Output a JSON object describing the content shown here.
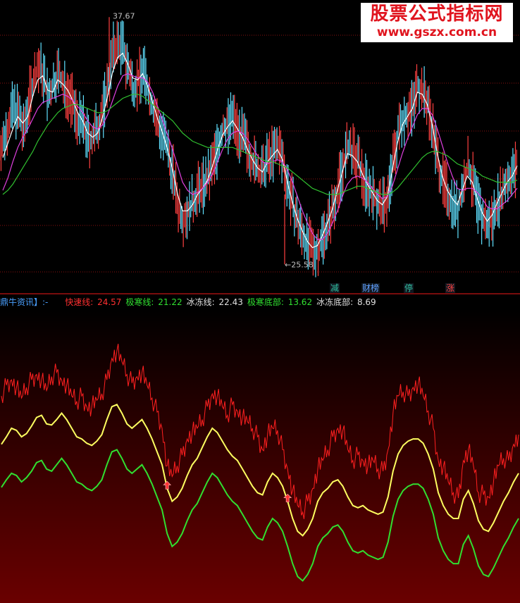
{
  "watermark": {
    "name": "股票公式指标网",
    "url": "www.gszx.com.cn"
  },
  "top_panel": {
    "high_label": "37.67",
    "low_label": "←25.58",
    "markers": [
      {
        "label": "减",
        "color": "#30c0a0"
      },
      {
        "label": "财榜",
        "color": "#60a0ff"
      },
      {
        "label": "停",
        "color": "#30c0a0"
      },
      {
        "label": "涨",
        "color": "#ff4040"
      }
    ]
  },
  "legend": {
    "title": "鼎牛资讯】:-",
    "items": [
      {
        "name": "快速线:",
        "value": "24.57",
        "color": "#ff3030"
      },
      {
        "name": "极寒线:",
        "value": "21.22",
        "color": "#30e030"
      },
      {
        "name": "冰冻线:",
        "value": "22.43",
        "color": "#e0e0e0"
      },
      {
        "name": "极寒底部:",
        "value": "13.62",
        "color": "#30e030"
      },
      {
        "name": "冰冻底部:",
        "value": "8.69",
        "color": "#e0e0e0"
      }
    ]
  },
  "chart_data": [
    {
      "type": "candlestick",
      "title": "",
      "y_range": [
        24.8,
        38.3
      ],
      "annotations": [
        {
          "text": "37.67",
          "y": 37.67
        },
        {
          "text": "←25.58",
          "y": 25.58
        }
      ],
      "close": [
        31.5,
        32.6,
        33.2,
        33.0,
        32.0,
        33.6,
        34.6,
        35.3,
        34.8,
        33.6,
        34.4,
        35.0,
        34.2,
        34.0,
        33.3,
        32.6,
        32.4,
        31.6,
        31.8,
        32.4,
        33.2,
        34.6,
        36.0,
        36.4,
        36.1,
        35.1,
        34.2,
        34.6,
        35.1,
        34.0,
        33.2,
        32.4,
        31.8,
        31.0,
        30.0,
        28.4,
        27.9,
        28.2,
        28.6,
        29.2,
        29.4,
        29.8,
        30.6,
        31.4,
        32.2,
        32.4,
        32.8,
        32.1,
        31.7,
        31.2,
        30.6,
        30.2,
        30.0,
        30.8,
        31.0,
        31.4,
        30.6,
        29.4,
        28.4,
        27.6,
        27.0,
        26.5,
        26.2,
        26.4,
        27.0,
        27.6,
        28.4,
        29.4,
        30.4,
        31.3,
        31.0,
        30.6,
        29.8,
        29.4,
        29.0,
        28.6,
        28.4,
        28.9,
        30.6,
        32.0,
        32.8,
        33.0,
        33.4,
        34.4,
        34.0,
        33.4,
        32.2,
        30.6,
        29.6,
        29.0,
        28.6,
        28.2,
        29.4,
        30.4,
        29.6,
        28.4,
        27.8,
        27.5,
        27.9,
        28.7,
        29.2,
        29.8,
        30.0,
        30.6
      ],
      "ma_lines": [
        {
          "name": "white",
          "color": "#ffffff",
          "values": [
            30.8,
            31.5,
            32.2,
            32.8,
            32.5,
            32.8,
            33.8,
            34.6,
            34.8,
            34.1,
            34.0,
            34.6,
            34.4,
            34.1,
            33.6,
            33.0,
            32.6,
            32.0,
            31.8,
            32.0,
            32.8,
            33.8,
            35.0,
            35.7,
            35.9,
            35.4,
            34.7,
            34.6,
            34.9,
            34.3,
            33.5,
            32.7,
            32.0,
            31.2,
            30.2,
            29.0,
            28.2,
            28.2,
            28.5,
            29.0,
            29.3,
            29.7,
            30.4,
            31.2,
            31.9,
            32.3,
            32.6,
            32.2,
            31.8,
            31.2,
            30.7,
            30.3,
            30.1,
            30.6,
            30.9,
            31.2,
            30.7,
            29.6,
            28.6,
            27.8,
            27.2,
            26.7,
            26.4,
            26.5,
            27.0,
            27.6,
            28.3,
            29.2,
            30.1,
            31.0,
            30.9,
            30.6,
            30.0,
            29.5,
            29.1,
            28.7,
            28.5,
            28.9,
            30.2,
            31.5,
            32.4,
            32.8,
            33.2,
            34.0,
            33.9,
            33.4,
            32.4,
            31.0,
            29.9,
            29.2,
            28.8,
            28.5,
            29.2,
            29.9,
            29.6,
            28.8,
            28.1,
            27.7,
            28.0,
            28.6,
            29.1,
            29.6,
            29.9,
            30.4
          ]
        },
        {
          "name": "magenta",
          "color": "#e040e0",
          "values": [
            29.2,
            29.8,
            30.6,
            31.3,
            31.8,
            32.2,
            32.7,
            33.2,
            33.5,
            33.6,
            33.7,
            33.8,
            33.9,
            33.8,
            33.6,
            33.3,
            33.0,
            32.6,
            32.3,
            32.2,
            32.4,
            32.9,
            33.6,
            34.3,
            34.8,
            34.9,
            34.8,
            34.7,
            34.7,
            34.5,
            34.0,
            33.3,
            32.6,
            31.9,
            31.2,
            30.4,
            29.6,
            29.2,
            29.0,
            29.1,
            29.3,
            29.6,
            30.0,
            30.6,
            31.2,
            31.7,
            32.0,
            32.1,
            32.0,
            31.7,
            31.3,
            30.9,
            30.6,
            30.5,
            30.6,
            30.7,
            30.6,
            30.2,
            29.6,
            28.9,
            28.2,
            27.6,
            27.1,
            26.8,
            26.8,
            27.1,
            27.6,
            28.2,
            28.9,
            29.5,
            29.8,
            29.9,
            29.8,
            29.6,
            29.3,
            29.0,
            28.8,
            28.9,
            29.4,
            30.2,
            31.0,
            31.7,
            32.3,
            32.9,
            33.2,
            33.2,
            32.9,
            32.2,
            31.4,
            30.6,
            29.9,
            29.3,
            29.2,
            29.3,
            29.3,
            29.1,
            28.8,
            28.4,
            28.3,
            28.3,
            28.5,
            28.7,
            29.0,
            29.3
          ]
        },
        {
          "name": "green",
          "color": "#30c030",
          "values": [
            29.0,
            29.2,
            29.5,
            29.9,
            30.3,
            30.7,
            31.1,
            31.6,
            32.0,
            32.4,
            32.7,
            33.0,
            33.2,
            33.3,
            33.4,
            33.4,
            33.3,
            33.2,
            33.1,
            33.0,
            33.0,
            33.1,
            33.3,
            33.5,
            33.7,
            33.8,
            33.9,
            33.9,
            33.8,
            33.6,
            33.4,
            33.2,
            33.0,
            32.8,
            32.6,
            32.3,
            32.0,
            31.8,
            31.6,
            31.5,
            31.4,
            31.3,
            31.3,
            31.3,
            31.3,
            31.3,
            31.3,
            31.2,
            31.1,
            31.0,
            30.9,
            30.8,
            30.7,
            30.6,
            30.6,
            30.5,
            30.4,
            30.3,
            30.1,
            29.9,
            29.7,
            29.5,
            29.3,
            29.2,
            29.1,
            29.0,
            29.0,
            29.0,
            29.1,
            29.2,
            29.3,
            29.4,
            29.4,
            29.3,
            29.2,
            29.1,
            29.0,
            29.0,
            29.1,
            29.3,
            29.6,
            29.9,
            30.2,
            30.5,
            30.8,
            31.0,
            31.1,
            31.1,
            31.0,
            30.9,
            30.7,
            30.5,
            30.4,
            30.3,
            30.2,
            30.1,
            29.9,
            29.8,
            29.7,
            29.6,
            29.6,
            29.6,
            29.6,
            29.7
          ]
        }
      ]
    },
    {
      "type": "line",
      "title": "",
      "y_range": [
        5,
        32
      ],
      "series": [
        {
          "name": "快速线",
          "color": "#ff2020",
          "values": [
            24.0,
            25.0,
            25.5,
            24.8,
            23.8,
            24.8,
            25.5,
            26.0,
            25.5,
            24.5,
            25.8,
            26.2,
            25.5,
            25.0,
            24.0,
            23.5,
            24.0,
            23.0,
            23.0,
            23.6,
            24.2,
            25.5,
            27.5,
            28.2,
            27.2,
            26.0,
            25.2,
            25.8,
            26.2,
            25.0,
            23.8,
            22.5,
            21.0,
            17.5,
            16.5,
            17.5,
            18.5,
            20.0,
            20.6,
            21.0,
            21.8,
            23.0,
            24.2,
            24.0,
            23.0,
            22.2,
            23.2,
            22.6,
            22.0,
            21.6,
            21.0,
            20.2,
            19.0,
            20.4,
            21.0,
            20.8,
            19.0,
            17.2,
            15.2,
            13.8,
            13.2,
            14.2,
            15.4,
            17.2,
            18.0,
            19.0,
            20.2,
            21.0,
            20.8,
            19.0,
            18.0,
            18.5,
            18.0,
            17.5,
            18.0,
            17.2,
            17.0,
            19.0,
            22.4,
            24.0,
            24.4,
            24.0,
            24.8,
            25.2,
            24.0,
            22.6,
            21.0,
            18.0,
            17.4,
            16.0,
            15.0,
            14.5,
            18.0,
            19.0,
            17.5,
            15.0,
            14.8,
            14.6,
            16.0,
            17.5,
            18.2,
            18.0,
            19.5,
            20.4
          ]
        },
        {
          "name": "冰冻线",
          "color": "#ffff60",
          "values": [
            19.5,
            20.2,
            21.0,
            20.8,
            20.2,
            20.5,
            21.2,
            22.0,
            22.2,
            21.4,
            21.3,
            21.8,
            22.4,
            21.8,
            21.0,
            20.2,
            20.0,
            19.6,
            19.4,
            19.8,
            20.4,
            21.8,
            23.0,
            23.2,
            22.4,
            21.4,
            21.0,
            21.4,
            21.8,
            21.0,
            20.0,
            18.8,
            17.6,
            15.4,
            14.2,
            14.6,
            15.4,
            16.6,
            17.6,
            18.2,
            19.2,
            20.2,
            21.0,
            20.6,
            19.8,
            19.0,
            18.4,
            18.0,
            17.2,
            16.4,
            15.6,
            15.0,
            14.8,
            16.0,
            16.8,
            16.4,
            15.6,
            14.2,
            12.6,
            11.4,
            11.0,
            11.6,
            12.6,
            14.2,
            15.0,
            15.4,
            16.0,
            16.2,
            15.6,
            14.6,
            13.8,
            13.6,
            13.8,
            13.4,
            13.2,
            13.0,
            13.2,
            14.6,
            17.0,
            18.6,
            19.4,
            19.8,
            20.0,
            20.0,
            19.6,
            18.6,
            17.2,
            15.0,
            13.8,
            13.0,
            12.6,
            12.6,
            14.4,
            15.2,
            14.0,
            12.4,
            11.6,
            11.4,
            12.2,
            13.2,
            14.2,
            15.0,
            16.0,
            16.8
          ]
        },
        {
          "name": "极寒线",
          "color": "#30e030",
          "values": [
            15.5,
            16.2,
            16.8,
            16.6,
            16.0,
            16.4,
            17.0,
            17.8,
            18.0,
            17.2,
            17.0,
            17.6,
            18.2,
            17.6,
            16.8,
            16.0,
            15.8,
            15.4,
            15.2,
            15.6,
            16.2,
            17.6,
            18.8,
            19.0,
            18.2,
            17.2,
            16.8,
            17.2,
            17.6,
            16.8,
            15.8,
            14.6,
            13.4,
            11.2,
            10.0,
            10.4,
            11.2,
            12.4,
            13.4,
            14.0,
            15.0,
            16.0,
            16.8,
            16.4,
            15.6,
            14.8,
            14.2,
            13.8,
            13.0,
            12.2,
            11.4,
            10.8,
            10.6,
            11.8,
            12.6,
            12.2,
            11.4,
            10.0,
            8.4,
            7.2,
            6.8,
            7.4,
            8.4,
            10.0,
            10.8,
            11.2,
            11.8,
            12.0,
            11.4,
            10.4,
            9.6,
            9.4,
            9.6,
            9.2,
            9.0,
            8.8,
            9.0,
            10.4,
            12.8,
            14.4,
            15.2,
            15.6,
            15.8,
            15.8,
            15.4,
            14.4,
            13.0,
            10.8,
            9.6,
            8.8,
            8.4,
            8.4,
            10.2,
            11.0,
            9.8,
            8.2,
            7.4,
            7.2,
            8.0,
            9.0,
            10.0,
            10.8,
            11.8,
            12.6
          ]
        }
      ],
      "signals": [
        {
          "index": 33,
          "type": "up-arrow"
        },
        {
          "index": 57,
          "type": "up-arrow"
        }
      ]
    }
  ]
}
